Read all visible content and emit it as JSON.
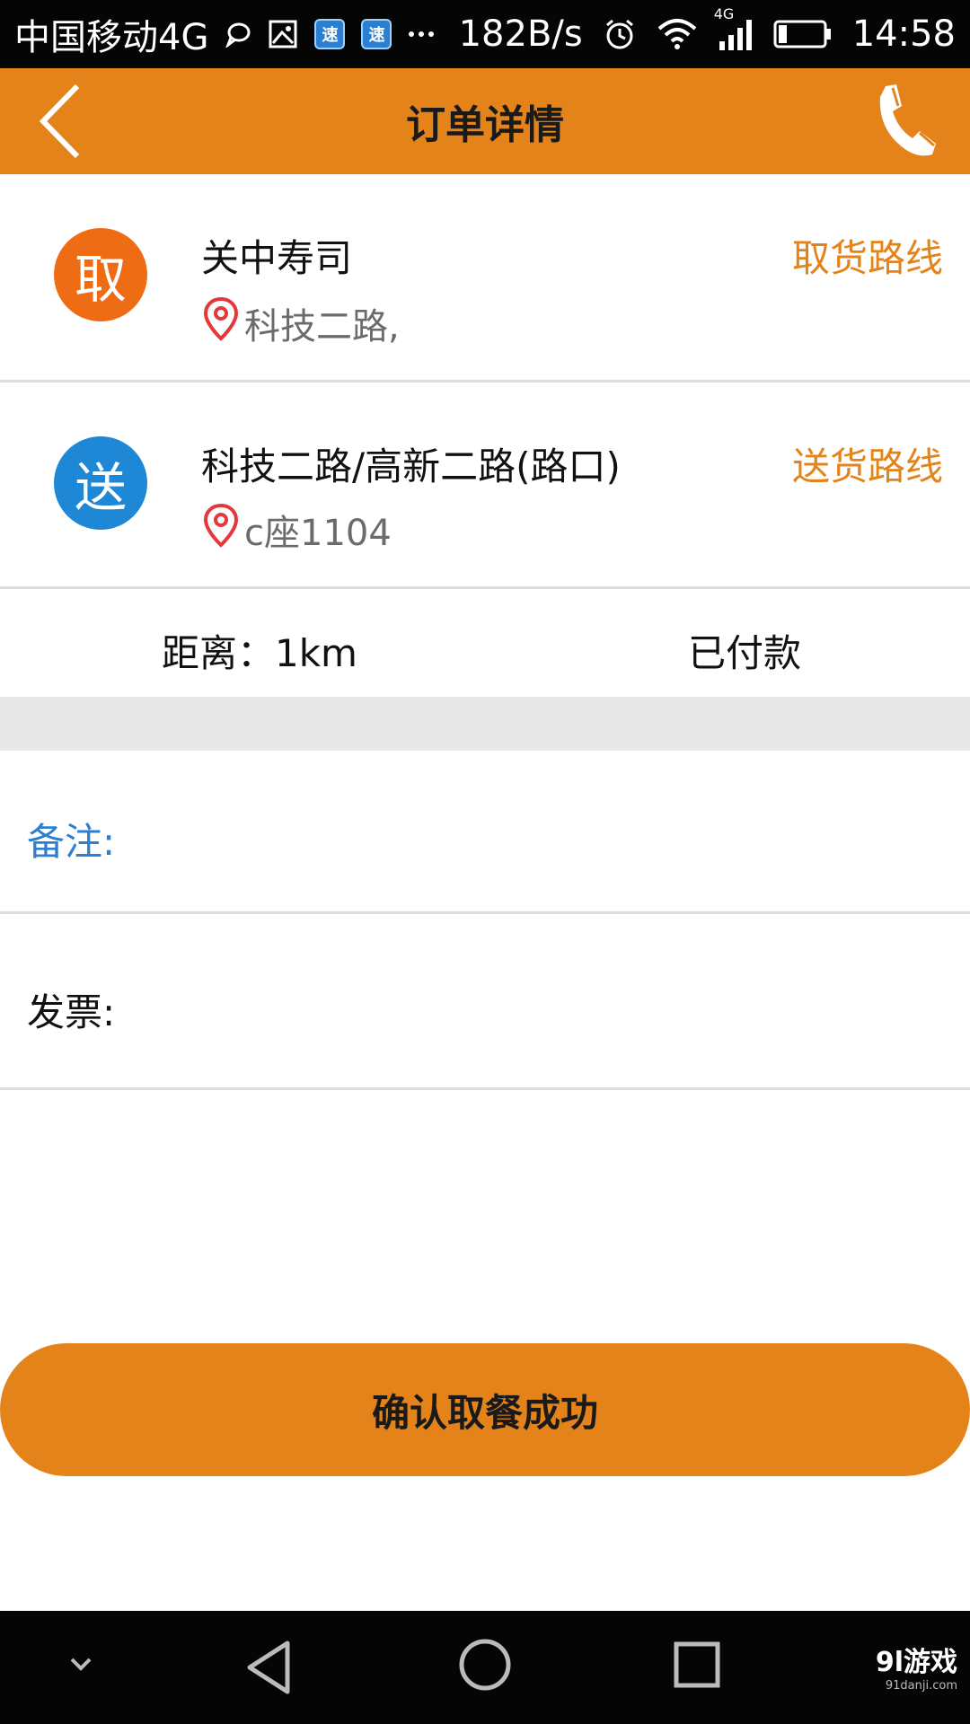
{
  "status_bar": {
    "carrier": "中国移动4G",
    "net_speed": "182B/s",
    "signal_label": "4G",
    "time": "14:58"
  },
  "header": {
    "title": "订单详情"
  },
  "pickup": {
    "badge": "取",
    "name": "关中寿司",
    "address": "科技二路,",
    "route_label": "取货路线"
  },
  "delivery": {
    "badge": "送",
    "name": "科技二路/高新二路(路口)",
    "address": "c座1104",
    "route_label": "送货路线"
  },
  "summary": {
    "distance": "距离：1km",
    "payment_status": "已付款"
  },
  "fields": {
    "remark_label": "备注:",
    "invoice_label": "发票:"
  },
  "confirm_button": "确认取餐成功",
  "watermark": {
    "brand": "9l游戏",
    "site": "91danji.com"
  },
  "colors": {
    "accent": "#e48319",
    "pickup_badge": "#ee6c14",
    "delivery_badge": "#1f88d6",
    "remark_label": "#2f7fd1",
    "pin": "#e5383b"
  }
}
